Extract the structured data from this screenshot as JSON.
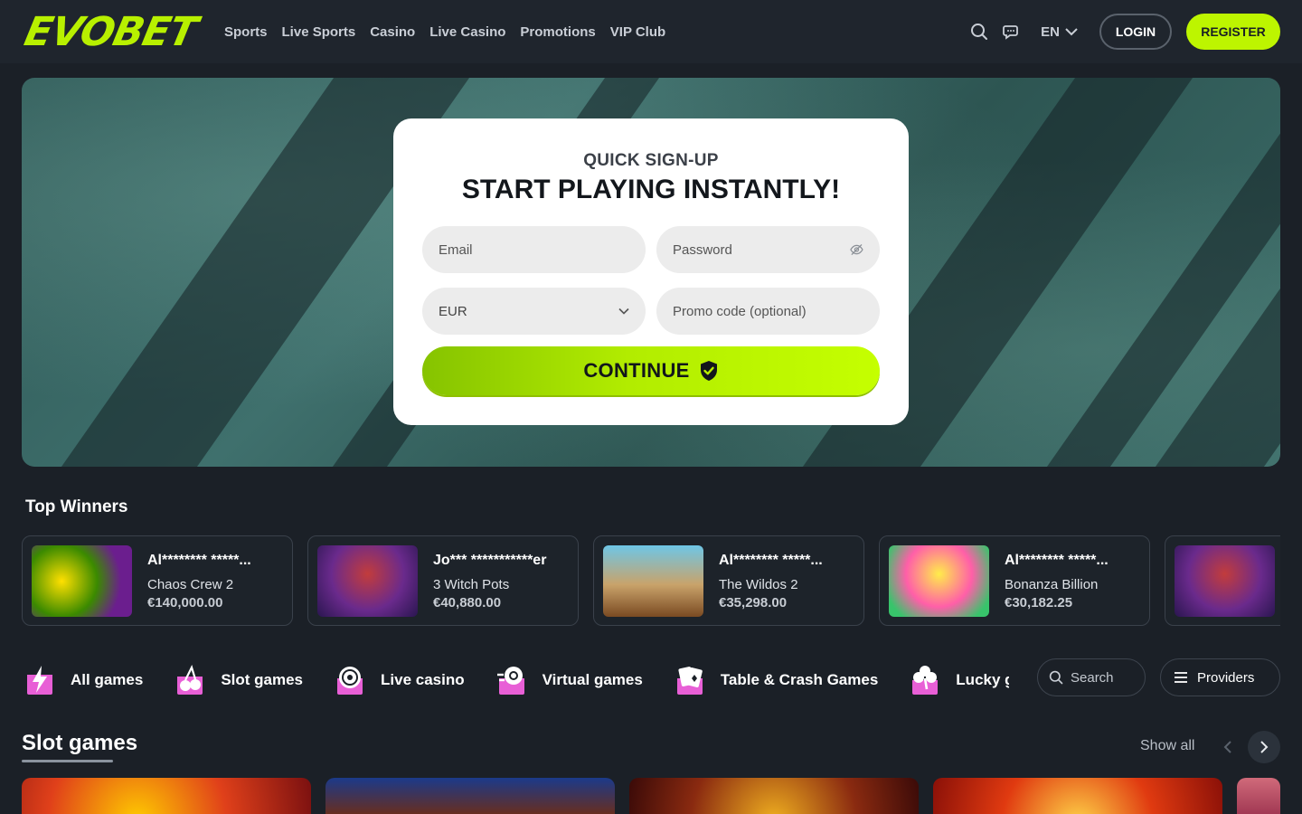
{
  "header": {
    "logo_text": "EVOBET",
    "nav": [
      "Sports",
      "Live Sports",
      "Casino",
      "Live Casino",
      "Promotions",
      "VIP Club"
    ],
    "lang": "EN",
    "login_label": "LOGIN",
    "register_label": "REGISTER"
  },
  "signup": {
    "subtitle": "QUICK SIGN-UP",
    "title": "START PLAYING INSTANTLY!",
    "email_placeholder": "Email",
    "password_placeholder": "Password",
    "currency": "EUR",
    "promo_placeholder": "Promo code (optional)",
    "continue_label": "CONTINUE"
  },
  "top_winners": {
    "title": "Top Winners",
    "items": [
      {
        "name": "Al******** *****...",
        "game": "Chaos Crew 2",
        "amount": "€140,000.00"
      },
      {
        "name": "Jo*** ***********er",
        "game": "3 Witch Pots",
        "amount": "€40,880.00"
      },
      {
        "name": "Al******** *****...",
        "game": "The Wildos 2",
        "amount": "€35,298.00"
      },
      {
        "name": "Al******** *****...",
        "game": "Bonanza Billion",
        "amount": "€30,182.25"
      },
      {
        "name": "",
        "game": "",
        "amount": ""
      }
    ]
  },
  "categories": {
    "items": [
      "All games",
      "Slot games",
      "Live casino",
      "Virtual games",
      "Table & Crash Games",
      "Lucky games"
    ],
    "search_placeholder": "Search",
    "providers_label": "Providers"
  },
  "slot_games": {
    "title": "Slot games",
    "show_all": "Show all"
  },
  "colors": {
    "accent": "#bdf500",
    "background": "#1b2027",
    "header": "#1f252d",
    "category_icon": "#e85fd6"
  }
}
